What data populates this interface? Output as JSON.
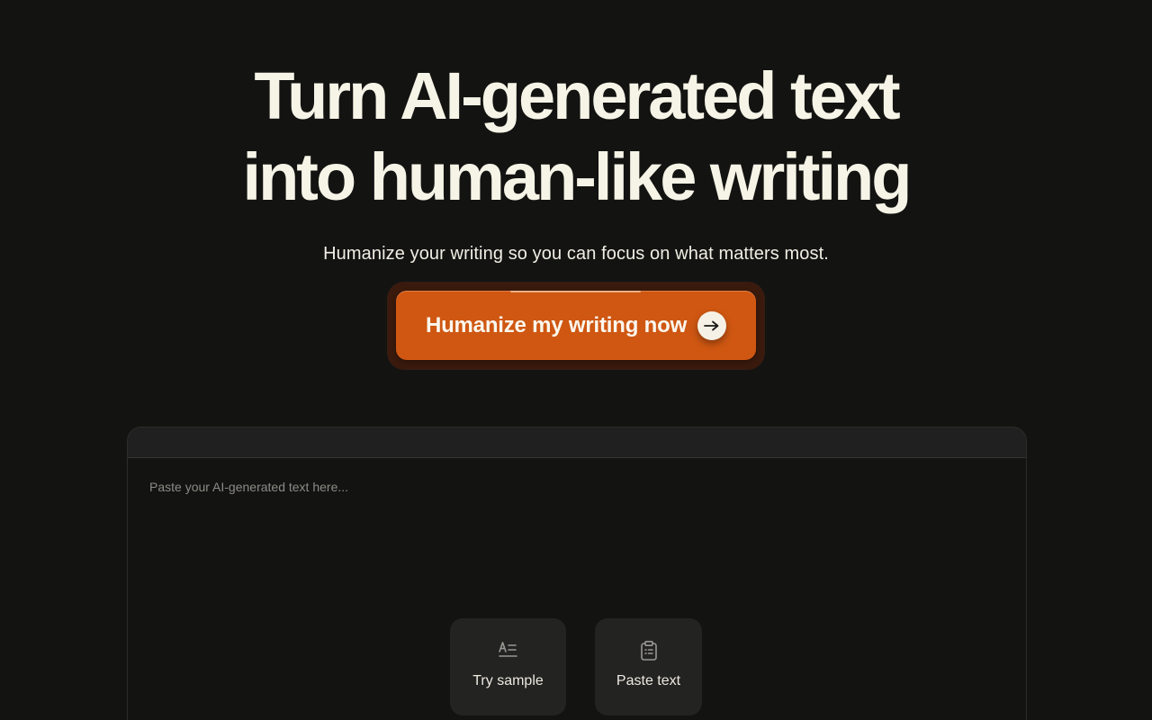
{
  "hero": {
    "headline_line1": "Turn AI-generated text",
    "headline_line2": "into human-like writing",
    "subtitle": "Humanize your writing so you can focus on what matters most."
  },
  "cta": {
    "label": "Humanize my writing now",
    "icon": "arrow-right-icon"
  },
  "editor": {
    "placeholder": "Paste your AI-generated text here...",
    "value": "",
    "actions": [
      {
        "label": "Try sample",
        "icon": "text-sample-icon"
      },
      {
        "label": "Paste text",
        "icon": "clipboard-icon"
      }
    ]
  },
  "colors": {
    "background": "#131312",
    "accent": "#cf5712",
    "text": "#f6f4e6"
  }
}
